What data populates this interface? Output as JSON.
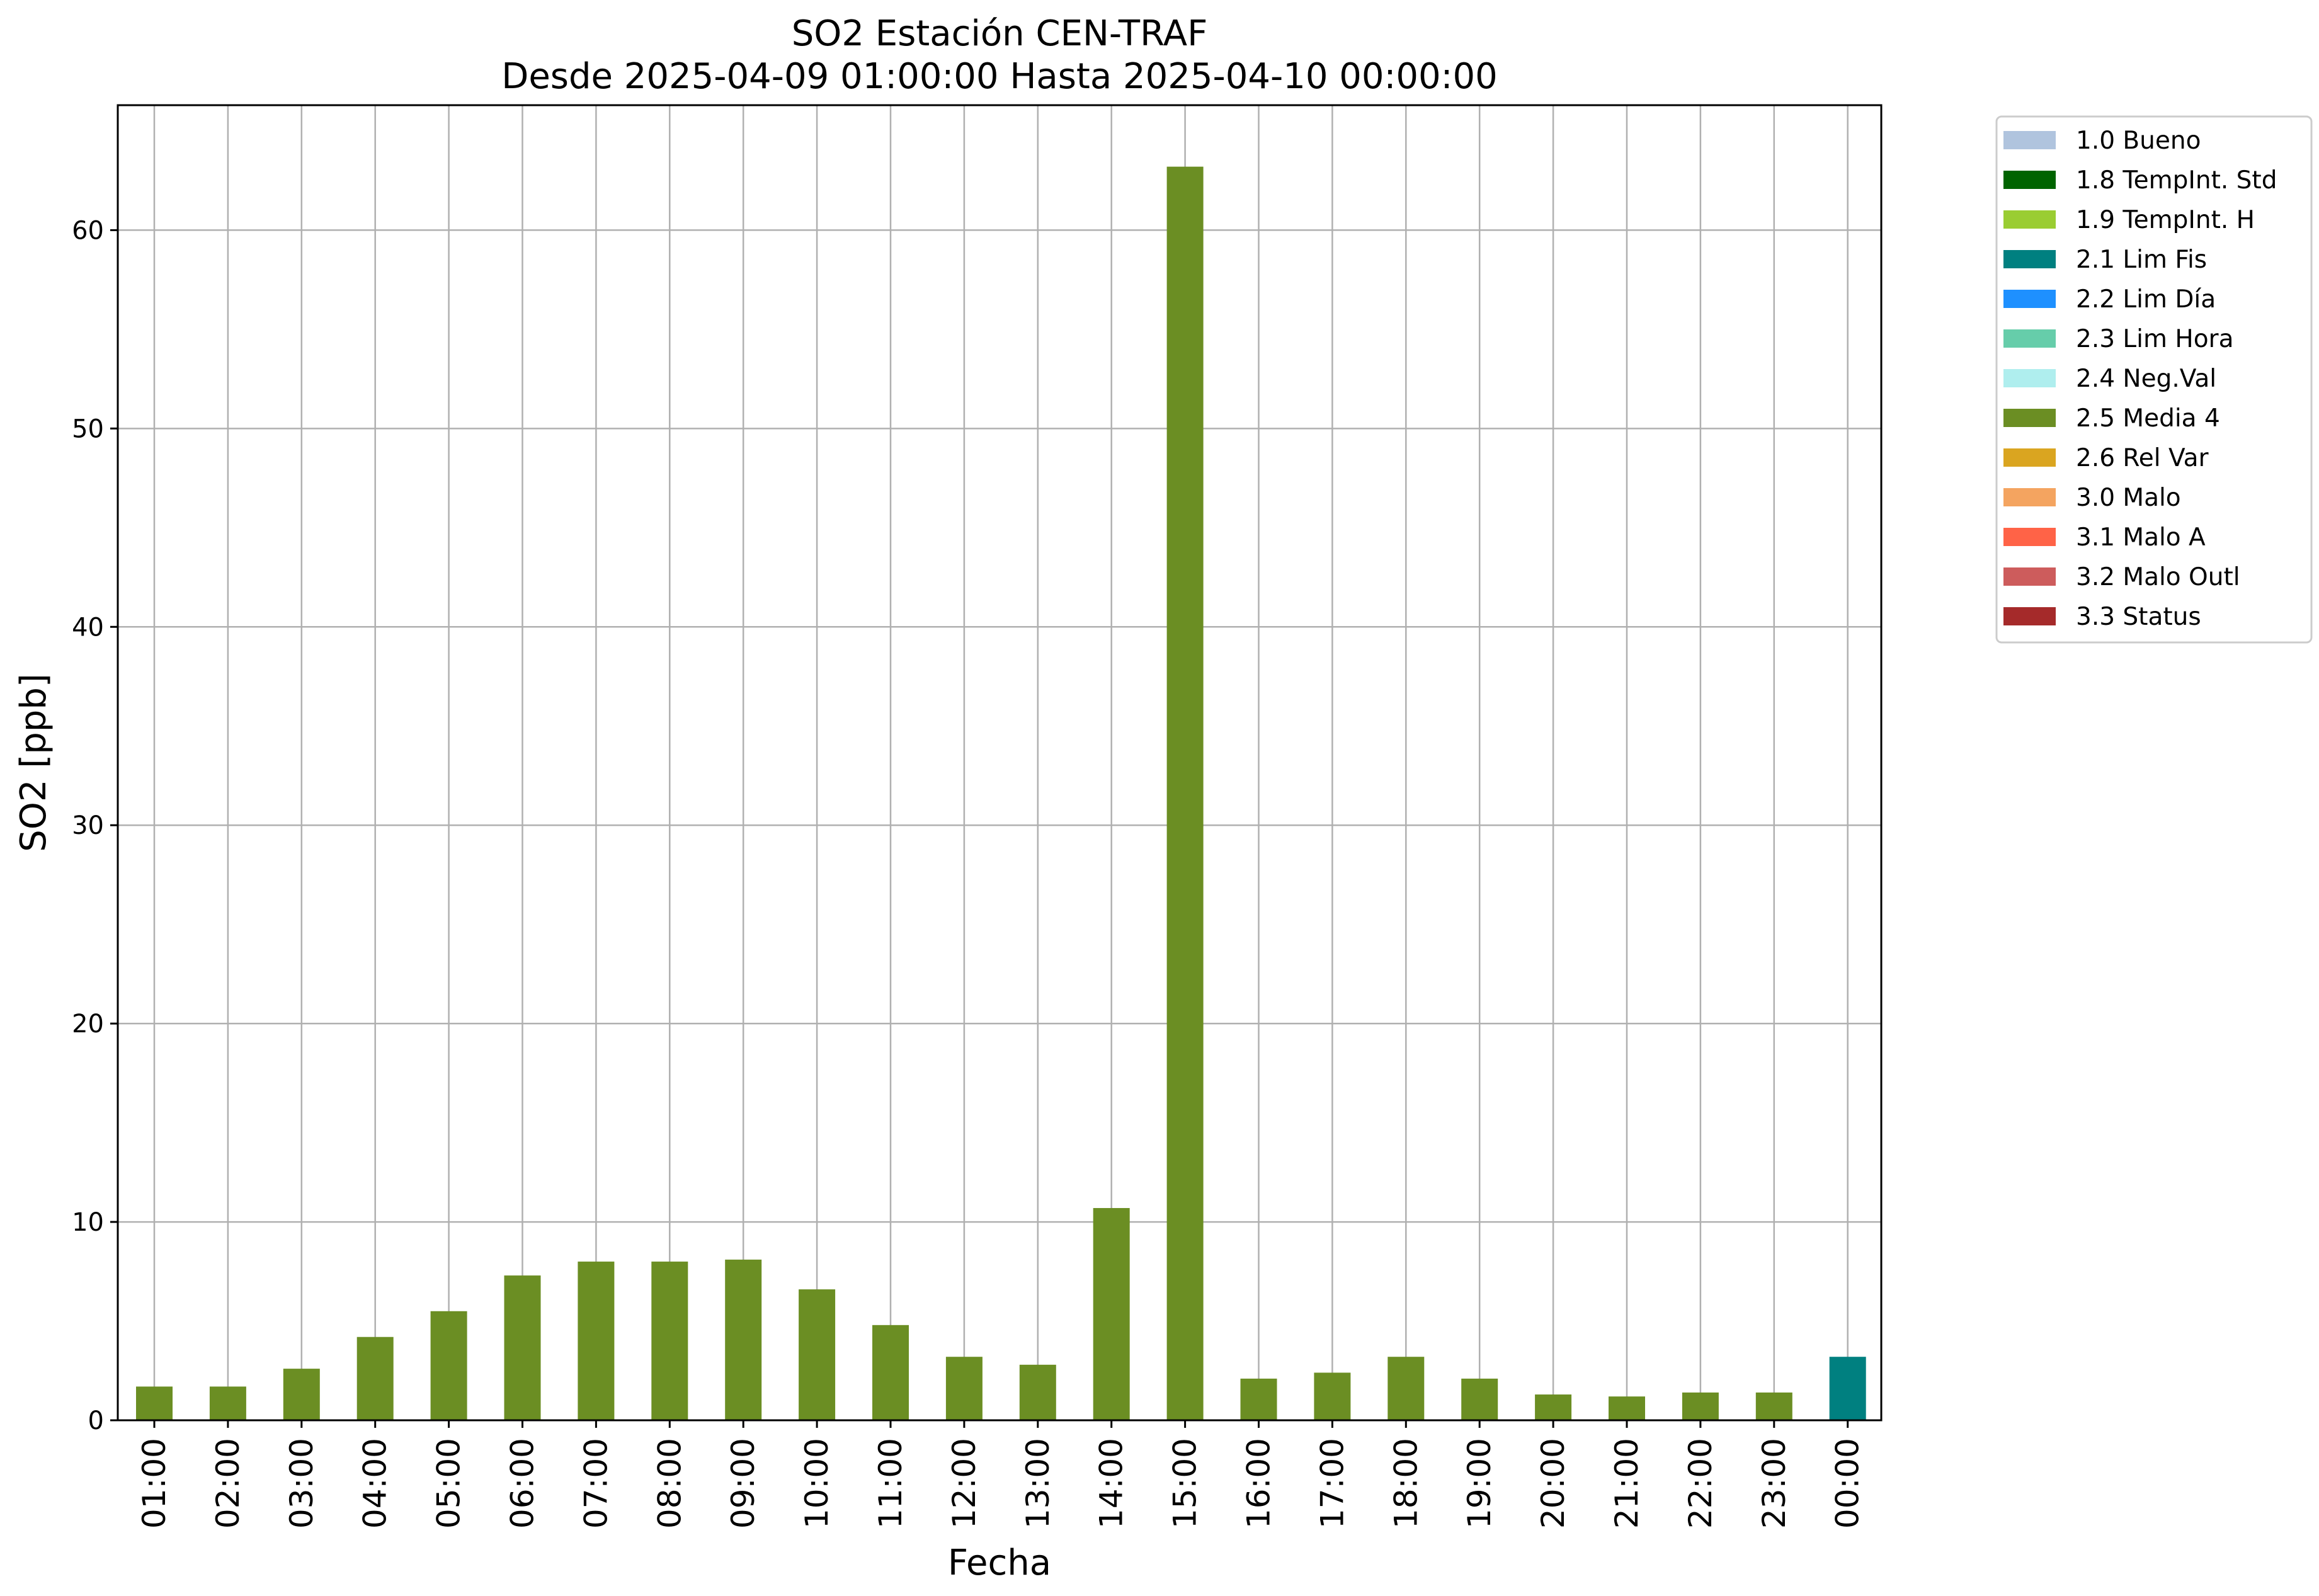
{
  "chart_data": {
    "type": "bar",
    "title": "SO2 Estación CEN-TRAF",
    "subtitle": "Desde 2025-04-09 01:00:00 Hasta 2025-04-10 00:00:00",
    "xlabel": "Fecha",
    "ylabel": "SO2 [ppb]",
    "ylim": [
      0,
      66.3
    ],
    "yticks": [
      0,
      10,
      20,
      30,
      40,
      50,
      60
    ],
    "grid": true,
    "legend_position": "outside-right",
    "categories": [
      "01:00",
      "02:00",
      "03:00",
      "04:00",
      "05:00",
      "06:00",
      "07:00",
      "08:00",
      "09:00",
      "10:00",
      "11:00",
      "12:00",
      "13:00",
      "14:00",
      "15:00",
      "16:00",
      "17:00",
      "18:00",
      "19:00",
      "20:00",
      "21:00",
      "22:00",
      "23:00",
      "00:00"
    ],
    "values": [
      1.7,
      1.7,
      2.6,
      4.2,
      5.5,
      7.3,
      8.0,
      8.0,
      8.1,
      6.6,
      4.8,
      3.2,
      2.8,
      10.7,
      63.2,
      2.1,
      2.4,
      3.2,
      2.1,
      1.3,
      1.2,
      1.4,
      1.4,
      3.2
    ],
    "bar_flags": [
      "2.5 Media 4",
      "2.5 Media 4",
      "2.5 Media 4",
      "2.5 Media 4",
      "2.5 Media 4",
      "2.5 Media 4",
      "2.5 Media 4",
      "2.5 Media 4",
      "2.5 Media 4",
      "2.5 Media 4",
      "2.5 Media 4",
      "2.5 Media 4",
      "2.5 Media 4",
      "2.5 Media 4",
      "2.5 Media 4",
      "2.5 Media 4",
      "2.5 Media 4",
      "2.5 Media 4",
      "2.5 Media 4",
      "2.5 Media 4",
      "2.5 Media 4",
      "2.5 Media 4",
      "2.5 Media 4",
      "2.1 Lim Fis"
    ],
    "legend": [
      {
        "label": "1.0 Bueno",
        "color": "#b0c4de"
      },
      {
        "label": "1.8 TempInt. Std",
        "color": "#006400"
      },
      {
        "label": "1.9 TempInt. H",
        "color": "#9acd32"
      },
      {
        "label": "2.1 Lim Fis",
        "color": "#008080"
      },
      {
        "label": "2.2 Lim Día",
        "color": "#1e90ff"
      },
      {
        "label": "2.3 Lim Hora",
        "color": "#66cdaa"
      },
      {
        "label": "2.4 Neg.Val",
        "color": "#afeeee"
      },
      {
        "label": "2.5 Media 4",
        "color": "#6b8e23"
      },
      {
        "label": "2.6 Rel Var",
        "color": "#daa520"
      },
      {
        "label": "3.0 Malo",
        "color": "#f4a460"
      },
      {
        "label": "3.1 Malo A",
        "color": "#ff6347"
      },
      {
        "label": "3.2 Malo Outl",
        "color": "#cd5c5c"
      },
      {
        "label": "3.3 Status",
        "color": "#a52a2a"
      }
    ]
  }
}
